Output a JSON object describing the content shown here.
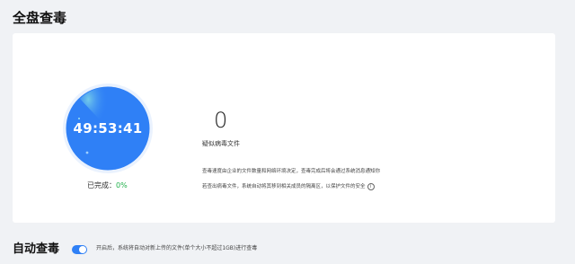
{
  "page": {
    "title": "全盘查毒"
  },
  "scan": {
    "timer": "49:53:41",
    "progress_label": "已完成：",
    "progress_value": "0%",
    "progress_fraction": 0.0,
    "ring_color": "#2f80f6",
    "ring_border_color": "#d9e7fd"
  },
  "result": {
    "count": "0",
    "count_label": "疑似病毒文件",
    "description_line1": "查毒速度由企业的文件数量和网络环境决定，查毒完成后将会通过系统消息通知你",
    "description_line2": "若查出病毒文件，系统自动将其移到相关成员的隔离区，以保护文件的安全",
    "info_icon": "info-icon"
  },
  "auto_scan": {
    "title": "自动查毒",
    "toggle_on": true,
    "toggle_color": "#2f80f6",
    "description": "开启后，系统将自动对新上传的文件(单个大小不超过1GB)进行查毒"
  }
}
